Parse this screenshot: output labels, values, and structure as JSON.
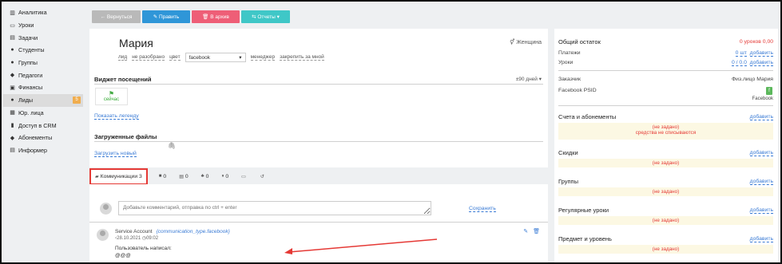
{
  "sidebar": {
    "items": [
      {
        "label": "Аналитика",
        "icon": "chart-icon"
      },
      {
        "label": "Уроки",
        "icon": "calendar-icon"
      },
      {
        "label": "Задачи",
        "icon": "tasks-icon"
      },
      {
        "label": "Студенты",
        "icon": "user-icon"
      },
      {
        "label": "Группы",
        "icon": "group-icon"
      },
      {
        "label": "Педагоги",
        "icon": "graduation-cap-icon"
      },
      {
        "label": "Финансы",
        "icon": "money-icon"
      },
      {
        "label": "Лиды",
        "icon": "lead-icon",
        "badge": "5"
      },
      {
        "label": "Юр. лица",
        "icon": "building-icon"
      },
      {
        "label": "Доступ в CRM",
        "icon": "lock-icon"
      },
      {
        "label": "Абонементы",
        "icon": "tag-icon"
      },
      {
        "label": "Информер",
        "icon": "list-icon"
      }
    ]
  },
  "toolbar": {
    "back": "← Вернуться",
    "edit": "✎ Править",
    "archive": "🗑 В архив",
    "reports": "⇆ Отчеты ▾"
  },
  "lead": {
    "name": "Мария",
    "gender": "⚥ Женщина",
    "prop1": "лид",
    "prop2": "не разобрано",
    "prop3": "цвет",
    "color_value": "facebook",
    "prop4": "менеджер",
    "prop5": "закрепить за мной"
  },
  "visits": {
    "title": "Виджет посещений",
    "days": "±90 дней ▾",
    "now": "сейчас",
    "legend_link": "Показать легенду"
  },
  "files": {
    "title": "Загруженные файлы",
    "upload_link": "Загрузить новый"
  },
  "tabs": [
    {
      "label": "Коммуникации 3",
      "icon": "comments-icon"
    },
    {
      "label": "0",
      "icon": "list-icon"
    },
    {
      "label": "0",
      "icon": "document-icon"
    },
    {
      "label": "0",
      "icon": "users-icon"
    },
    {
      "label": "0",
      "icon": "pause-icon"
    },
    {
      "label": "",
      "icon": "message-icon"
    },
    {
      "label": "",
      "icon": "history-icon"
    }
  ],
  "comment": {
    "placeholder": "Добавьте комментарий, отправка по ctrl + enter",
    "save": "Сохранить"
  },
  "message": {
    "author": "Service Account",
    "type": "{communication_type.facebook}",
    "date": "28.10.2021",
    "time": "09:02",
    "text": "Пользователь написал:",
    "body": "@@@"
  },
  "right": {
    "balance_title": "Общий остаток",
    "balance_value": "0 уроков  0,00",
    "payments_label": "Платежи",
    "payments_value": "0 шт",
    "lessons_label": "Уроки",
    "lessons_value": "0 / 0.0",
    "add": "добавить",
    "customer_label": "Заказчик",
    "customer_value": "Физ.лицо Мария",
    "psid_label": "Facebook PSID",
    "psid_value": "Facebook",
    "accounts_title": "Счета и абонементы",
    "not_set": "(не задано)",
    "no_debit": "средства не списываются",
    "discounts_title": "Скидки",
    "groups_title": "Группы",
    "regular_title": "Регулярные уроки",
    "subject_title": "Предмет и уровень"
  },
  "colors": {
    "accent": "#2f96d8",
    "danger": "#ee5e77",
    "info": "#3fc7c7",
    "highlight": "#e53935"
  }
}
